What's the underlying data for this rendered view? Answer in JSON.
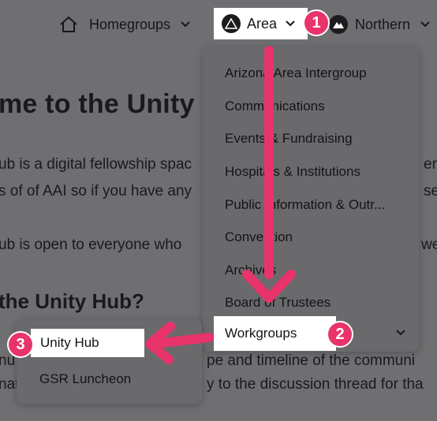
{
  "nav": {
    "homegroups_label": "Homegroups",
    "area_label": "Area",
    "northern_label": "Northern",
    "home_icon": "home-icon",
    "chevron_icon": "chevron-down-icon"
  },
  "page": {
    "heading": "me to the Unity H",
    "para1_line1": "ub is a digital fellowship spac",
    "para1_line1_right": "ere",
    "para1_line2": "s of of AAI so if you have any",
    "para1_line2_right": "se",
    "para2_line1": "ub is open to everyone who",
    "para2_line1_right": "we",
    "subheading": "the Unity Hub?",
    "para3_line1_left": "nu",
    "para3_line1_mid": "pe and timeline of the communi",
    "para3_line2_left": "nat",
    "para3_line2_mid": "y to the discussion thread for tha"
  },
  "area_menu": {
    "items": [
      "Arizona Area Intergroup",
      "Communications",
      "Events & Fundraising",
      "Hospitals & Institutions",
      "Public Information & Outr...",
      "Convention",
      "Archives",
      "Board of Trustees"
    ],
    "highlighted": "Workgroups"
  },
  "workgroups_menu": {
    "highlighted": "Unity Hub",
    "items": [
      "GSR Luncheon"
    ]
  },
  "annotations": {
    "badge1": "1",
    "badge2": "2",
    "badge3": "3",
    "accent": "#e8336b"
  }
}
